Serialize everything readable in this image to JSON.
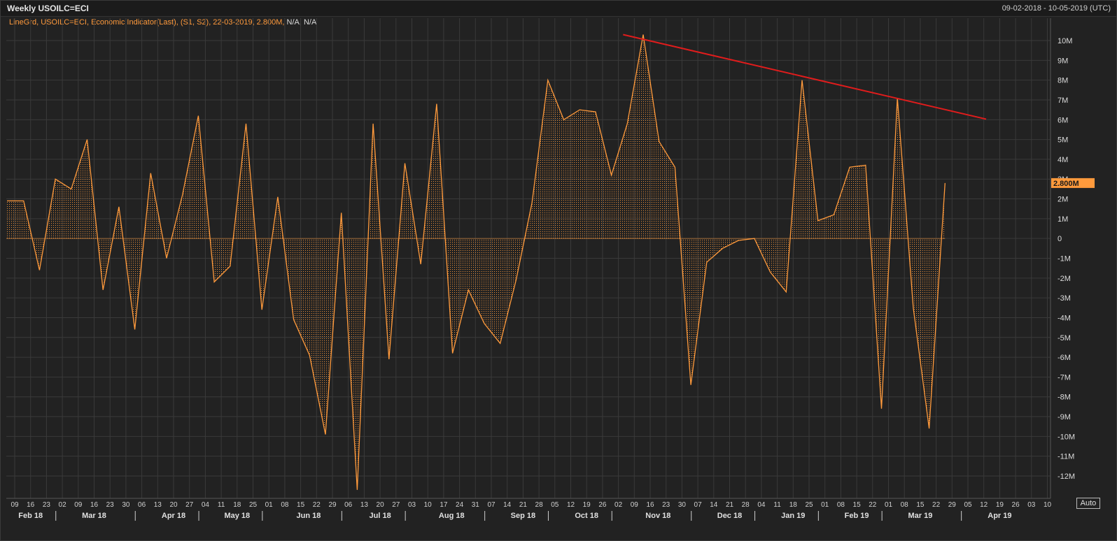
{
  "header": {
    "title": "Weekly USOILC=ECI",
    "date_range": "09-02-2018 - 10-05-2019 (UTC)"
  },
  "legend": {
    "text": "LineGrd, USOILC=ECI, Economic Indicator(Last), (S1, S2), 22-03-2019, 2.800M,",
    "na": "N/A, N/A"
  },
  "auto_button": "Auto",
  "colors": {
    "series": "#ff9a3c",
    "trendline": "#e01c1c",
    "background": "#222222",
    "grid": "#3a3a3a",
    "last_value_bg": "#ff9a3c"
  },
  "chart_data": {
    "type": "area",
    "title": "Weekly USOILC=ECI",
    "ylim": [
      -12.5,
      10.5
    ],
    "yticks": [
      10,
      9,
      8,
      7,
      6,
      5,
      4,
      3,
      2,
      1,
      0,
      -1,
      -2,
      -3,
      -4,
      -5,
      -6,
      -7,
      -8,
      -9,
      -10,
      -11,
      -12
    ],
    "ytick_labels": [
      "10M",
      "9M",
      "8M",
      "7M",
      "6M",
      "5M",
      "4M",
      "3M",
      "2M",
      "1M",
      "0",
      "-1M",
      "-2M",
      "-3M",
      "-4M",
      "-5M",
      "-6M",
      "-7M",
      "-8M",
      "-9M",
      "-10M",
      "-11M",
      "-12M"
    ],
    "grid": true,
    "last_value_label": "2.800M",
    "x_labels": [
      "09",
      "16",
      "23",
      "02",
      "09",
      "16",
      "23",
      "30",
      "06",
      "13",
      "20",
      "27",
      "04",
      "11",
      "18",
      "25",
      "01",
      "08",
      "15",
      "22",
      "29",
      "06",
      "13",
      "20",
      "27",
      "03",
      "10",
      "17",
      "24",
      "31",
      "07",
      "14",
      "21",
      "28",
      "05",
      "12",
      "19",
      "26",
      "02",
      "09",
      "16",
      "23",
      "30",
      "07",
      "14",
      "21",
      "28",
      "04",
      "11",
      "18",
      "25",
      "01",
      "08",
      "15",
      "22",
      "01",
      "08",
      "15",
      "22",
      "29",
      "05",
      "12",
      "19",
      "26",
      "03",
      "10"
    ],
    "month_labels": [
      {
        "label": "Feb 18",
        "index": 1
      },
      {
        "label": "Mar 18",
        "index": 5
      },
      {
        "label": "Apr 18",
        "index": 10
      },
      {
        "label": "May 18",
        "index": 14
      },
      {
        "label": "Jun 18",
        "index": 18.5
      },
      {
        "label": "Jul 18",
        "index": 23
      },
      {
        "label": "Aug 18",
        "index": 27.5
      },
      {
        "label": "Sep 18",
        "index": 32
      },
      {
        "label": "Oct 18",
        "index": 36
      },
      {
        "label": "Nov 18",
        "index": 40.5
      },
      {
        "label": "Dec 18",
        "index": 45
      },
      {
        "label": "Jan 19",
        "index": 49
      },
      {
        "label": "Feb 19",
        "index": 53
      },
      {
        "label": "Mar 19",
        "index": 57
      },
      {
        "label": "Apr 19",
        "index": 62
      }
    ],
    "month_dividers": [
      3,
      8,
      12,
      16,
      21,
      25,
      30,
      34,
      38,
      43,
      47,
      51,
      55,
      60
    ],
    "series": [
      {
        "values": [
          1.9,
          1.9,
          -1.6,
          3.0,
          2.5,
          5.0,
          -2.6,
          1.6,
          -4.6,
          3.3,
          -1.0,
          2.2,
          6.2,
          -2.2,
          -1.4,
          5.8,
          -3.6,
          2.1,
          -4.1,
          -5.9,
          -9.9,
          1.3,
          -12.7,
          5.8,
          -6.1,
          3.8,
          -1.3,
          6.8,
          -5.8,
          -2.6,
          -4.3,
          -5.3,
          -2.1,
          1.8,
          8.0,
          6.0,
          6.5,
          6.4,
          3.2,
          5.8,
          10.3,
          4.9,
          3.6,
          -7.4,
          -1.2,
          -0.5,
          -0.1,
          0.0,
          -1.7,
          -2.7,
          8.0,
          0.9,
          1.2,
          3.6,
          3.7,
          -8.6,
          7.1,
          -3.5,
          -9.6,
          2.8
        ]
      }
    ],
    "trendline": {
      "x": [
        39,
        60
      ],
      "y": [
        10.3,
        6.1
      ]
    }
  }
}
